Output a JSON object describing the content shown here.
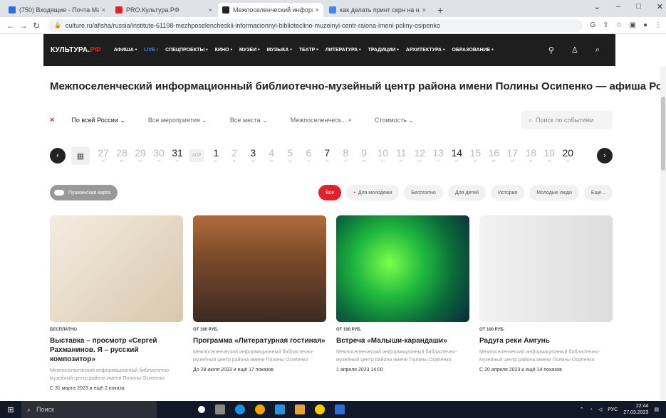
{
  "browser": {
    "tabs": [
      {
        "title": "(750) Входящие - Почта Mail.ru",
        "color": "#2a6fdb",
        "active": false
      },
      {
        "title": "PRO.Культура.РФ",
        "color": "#e0202a",
        "active": false
      },
      {
        "title": "Межпоселенческий информацион",
        "color": "#222222",
        "active": true
      },
      {
        "title": "как делать принт скрн на ноут",
        "color": "#4285f4",
        "active": false
      }
    ],
    "url": "culture.ru/afisha/russia/institute-61198-mezhposelencheskii-informacionnyi-biblioteclino-muzeinyi-centr-raiona-imeni-poliny-osipenko"
  },
  "site": {
    "logo_main": "КУЛЬТУРА.",
    "logo_accent": "РФ",
    "nav": [
      "АФИША •",
      "LIVE •",
      "СПЕЦПРОЕКТЫ •",
      "КИНО •",
      "МУЗЕИ •",
      "МУЗЫКА •",
      "ТЕАТР •",
      "ЛИТЕРАТУРА •",
      "ТРАДИЦИИ •",
      "АРХИТЕКТУРА •",
      "ОБРАЗОВАНИЕ •"
    ]
  },
  "page": {
    "title": "Межпоселенческий информационный библиотечно-музейный центр района имени Полины Осипенко — афиша России"
  },
  "filters": {
    "region": "По всей России ⌄",
    "events": "Все мероприятия ⌄",
    "places": "Все места ⌄",
    "venue": "Межпоселенческ... ×",
    "cost": "Стоимость ⌄",
    "search_placeholder": "Поиск по событиям"
  },
  "dates": {
    "march": [
      {
        "day": "27",
        "dow": "пн",
        "dark": false
      },
      {
        "day": "28",
        "dow": "вт",
        "dark": false
      },
      {
        "day": "29",
        "dow": "ср",
        "dark": false
      },
      {
        "day": "30",
        "dow": "чт",
        "dark": false
      },
      {
        "day": "31",
        "dow": "пт",
        "dark": true
      }
    ],
    "month_label": "АПР",
    "april": [
      {
        "day": "1",
        "dow": "сб",
        "dark": true
      },
      {
        "day": "2",
        "dow": "вс",
        "dark": false
      },
      {
        "day": "3",
        "dow": "пн",
        "dark": true
      },
      {
        "day": "4",
        "dow": "вт",
        "dark": false
      },
      {
        "day": "5",
        "dow": "ср",
        "dark": false
      },
      {
        "day": "6",
        "dow": "чт",
        "dark": false
      },
      {
        "day": "7",
        "dow": "пт",
        "dark": true
      },
      {
        "day": "8",
        "dow": "сб",
        "dark": false
      },
      {
        "day": "9",
        "dow": "вс",
        "dark": false
      },
      {
        "day": "10",
        "dow": "пн",
        "dark": false
      },
      {
        "day": "11",
        "dow": "вт",
        "dark": false
      },
      {
        "day": "12",
        "dow": "ср",
        "dark": false
      },
      {
        "day": "13",
        "dow": "чт",
        "dark": false
      },
      {
        "day": "14",
        "dow": "пт",
        "dark": true
      },
      {
        "day": "15",
        "dow": "сб",
        "dark": false
      },
      {
        "day": "16",
        "dow": "вс",
        "dark": false
      },
      {
        "day": "17",
        "dow": "пн",
        "dark": false
      },
      {
        "day": "18",
        "dow": "вт",
        "dark": false
      },
      {
        "day": "19",
        "dow": "ср",
        "dark": false
      },
      {
        "day": "20",
        "dow": "чт",
        "dark": true
      }
    ]
  },
  "chips": {
    "pushkin": "Пушкинская карта",
    "items": [
      "Все",
      "Для молодежи",
      "Бесплатно",
      "Для детей",
      "История",
      "Молодые люди",
      "Еще..."
    ]
  },
  "cards": [
    {
      "price": "БЕСПЛАТНО",
      "title": "Выставка – просмотр «Сергей Рахманинов. Я – русский композитор»",
      "place": "Межпоселенческий информационный библиотечно-музейный центр района имени Полины Осипенко",
      "date": "С 31 марта 2023 и ещё 2 показа"
    },
    {
      "price": "ОТ 100 РУБ.",
      "title": "Программа «Литературная гостиная»",
      "place": "Межпоселенческий информационный библиотечно-музейный центр района имени Полины Осипенко",
      "date": "До 28 июля 2023 и ещё 17 показов"
    },
    {
      "price": "ОТ 100 РУБ.",
      "title": "Встреча «Малыши-карандаши»",
      "place": "Межпоселенческий информационный библиотечно-музейный центр района имени Полины Осипенко",
      "date": "1 апреля 2023 14:00"
    },
    {
      "price": "ОТ 100 РУБ.",
      "title": "Радуга реки Амгунь",
      "place": "Межпоселенческий информационный библиотечно-музейный центр района имени Полины Осипенко",
      "date": "С 20 апреля 2023 и ещё 14 показов"
    }
  ],
  "taskbar": {
    "search": "Поиск",
    "lang": "РУС",
    "time": "22:44",
    "date": "27.03.2023"
  }
}
